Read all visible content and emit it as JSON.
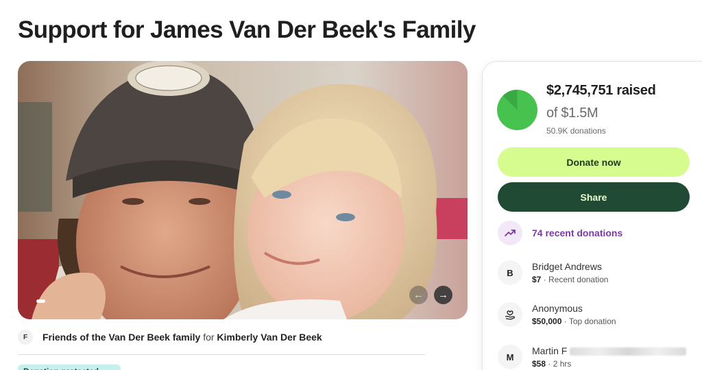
{
  "campaign": {
    "title": "Support for James Van Der Beek's Family"
  },
  "organizer": {
    "avatar_letter": "F",
    "name": "Friends of the Van Der Beek family",
    "for_word": "for",
    "beneficiary": "Kimberly Van Der Beek"
  },
  "badge": {
    "label": "Donation protected"
  },
  "stats": {
    "raised_text": "$2,745,751 raised",
    "goal_text": "of $1.5M",
    "donations_text": "50.9K donations",
    "progress_fraction": 1.0,
    "progress_color": "#3fc35c"
  },
  "buttons": {
    "donate_label": "Donate now",
    "share_label": "Share"
  },
  "recent": {
    "label": "74 recent donations",
    "icon": "trending-up-icon"
  },
  "donors": [
    {
      "avatar": "B",
      "name": "Bridget Andrews",
      "amount": "$7",
      "note": "· Recent donation"
    },
    {
      "avatar": "",
      "avatar_icon": "heart-hand-icon",
      "name": "Anonymous",
      "amount": "$50,000",
      "note": "· Top donation"
    },
    {
      "avatar": "M",
      "name": "Martin F",
      "amount": "$58",
      "note": "· 2 hrs"
    }
  ],
  "hero": {
    "nav_prev": "←",
    "nav_next": "→"
  },
  "colors": {
    "accent_green": "#d6fb8f",
    "dark_green": "#204a34",
    "purple": "#7b3aa5"
  }
}
